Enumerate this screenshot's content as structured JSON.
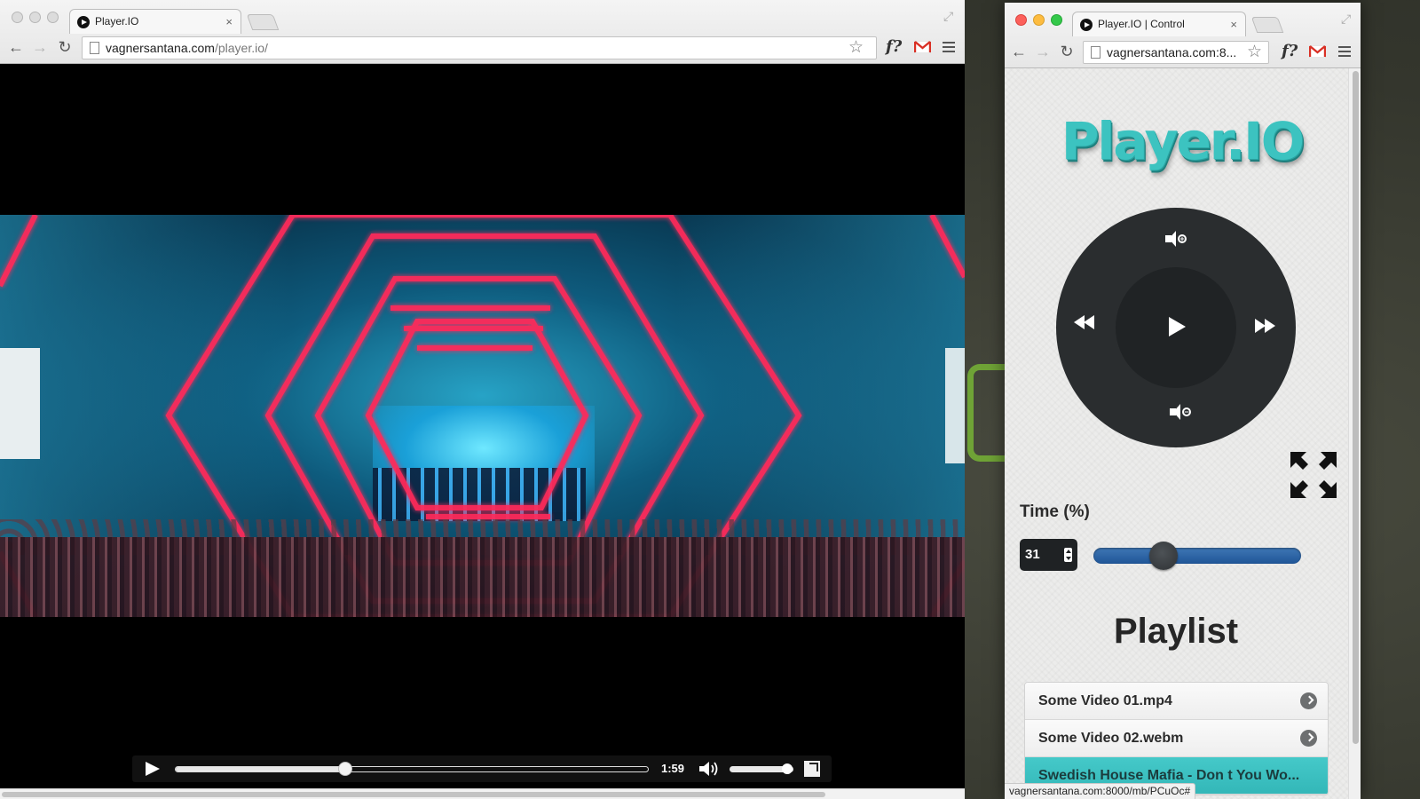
{
  "main_window": {
    "tab": {
      "title": "Player.IO",
      "close": "×"
    },
    "url": {
      "host": "vagnersantana.com",
      "path": "/player.io/"
    },
    "extension_label": "f?",
    "video": {
      "current_time": "1:59",
      "progress_fraction": 0.36,
      "volume_fraction": 0.9
    }
  },
  "control_window": {
    "tab": {
      "title": "Player.IO | Control",
      "close": "×"
    },
    "url": {
      "host": "vagnersantana.com:8..."
    },
    "extension_label": "f?",
    "app": {
      "logo": "Player.IO",
      "time_label": "Time (%)",
      "time_value": "31",
      "time_percent": 31,
      "playlist_title": "Playlist",
      "playlist": [
        {
          "name": "Some Video 01.mp4",
          "active": false
        },
        {
          "name": "Some Video 02.webm",
          "active": false
        },
        {
          "name": "Swedish House Mafia - Don t You Wo...",
          "active": true
        }
      ],
      "status_url": "vagnersantana.com:8000/mb/PCuOc#"
    }
  },
  "colors": {
    "logo_teal": "#3cc3c0",
    "dial_dark": "#2a2d2f",
    "range_blue": "#2b64a6",
    "active_item": "#3cc0c0",
    "neon_red": "#ff2a5a"
  },
  "icons": [
    "back-icon",
    "forward-icon",
    "reload-icon",
    "page-icon",
    "star-icon",
    "gmail-icon",
    "menu-icon",
    "play-icon",
    "volume-icon",
    "fullscreen-icon",
    "rewind-icon",
    "fast-forward-icon",
    "volume-up-icon",
    "volume-down-icon",
    "expand-arrows-icon",
    "chevron-right-icon"
  ]
}
